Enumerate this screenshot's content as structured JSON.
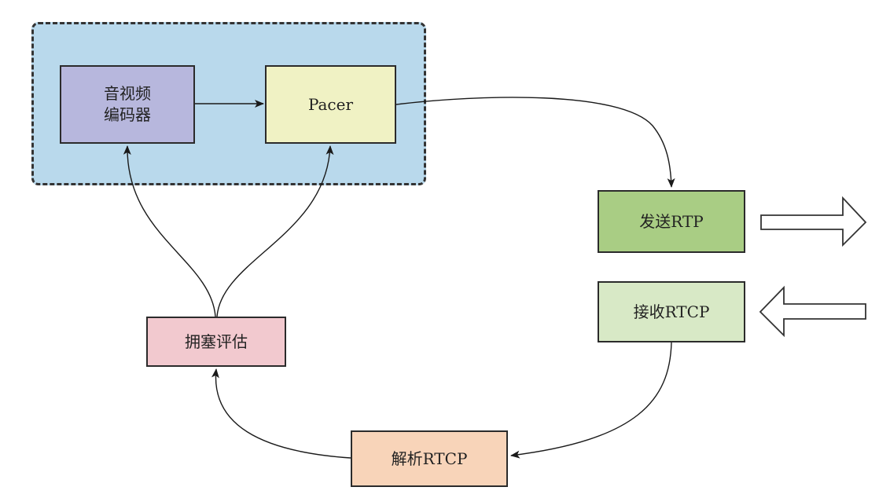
{
  "diagram": {
    "nodes": {
      "codec": {
        "line1": "音视频",
        "line2": "编码器"
      },
      "pacer": {
        "label": "Pacer"
      },
      "send_rtp": {
        "label": "发送RTP"
      },
      "recv_rtcp": {
        "label": "接收RTCP"
      },
      "congestion": {
        "label": "拥塞评估"
      },
      "parse_rtcp": {
        "label": "解析RTCP"
      }
    },
    "edges": [
      {
        "from": "codec",
        "to": "pacer"
      },
      {
        "from": "pacer",
        "to": "send_rtp"
      },
      {
        "from": "recv_rtcp",
        "to": "parse_rtcp"
      },
      {
        "from": "parse_rtcp",
        "to": "congestion"
      },
      {
        "from": "congestion",
        "to": "codec"
      },
      {
        "from": "congestion",
        "to": "pacer"
      }
    ],
    "side_arrows": [
      {
        "name": "outgoing",
        "direction": "right",
        "attached_to": "send_rtp"
      },
      {
        "name": "incoming",
        "direction": "left",
        "attached_to": "recv_rtcp"
      }
    ],
    "colors": {
      "group_fill": "#b9d9ec",
      "codec_fill": "#b7b7dd",
      "pacer_fill": "#f0f2c4",
      "send_fill": "#a9cd84",
      "recv_fill": "#d8e9c6",
      "congestion_fill": "#f2c9cf",
      "parse_fill": "#f8d4b9",
      "stroke": "#2b2b2b"
    }
  }
}
